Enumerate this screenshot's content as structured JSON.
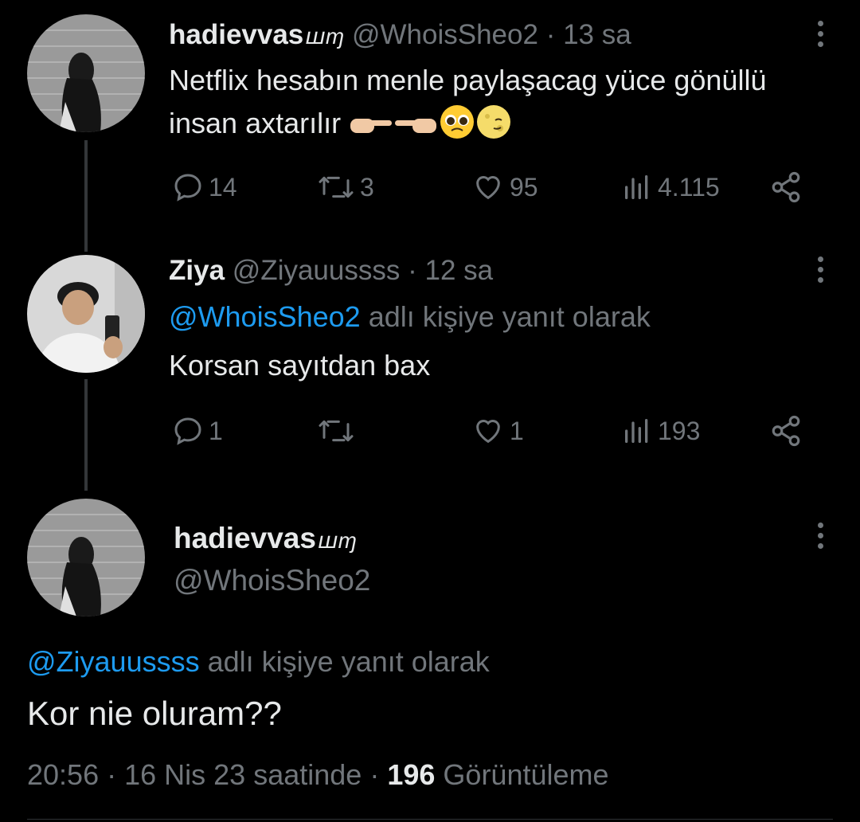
{
  "tweets": [
    {
      "name": "hadievvas",
      "name_glyph": "ꟺɱ",
      "handle": "@WhoisSheo2",
      "separator": "·",
      "time": "13 sa",
      "text": "Netflix hesabın menle paylaşacag yüce gönüllü insan axtarılır",
      "emoji": [
        "pointing-right-hand",
        "pointing-left-hand",
        "pleading-face",
        "smirking-moon"
      ],
      "actions": {
        "replies": "14",
        "retweets": "3",
        "likes": "95",
        "views": "4.115"
      }
    },
    {
      "name": "Ziya",
      "handle": "@Ziyauussss",
      "separator": "·",
      "time": "12 sa",
      "reply_to_mention": "@WhoisSheo2",
      "reply_to_suffix": "adlı kişiye yanıt olarak",
      "text": "Korsan sayıtdan bax",
      "actions": {
        "replies": "1",
        "retweets": "",
        "likes": "1",
        "views": "193"
      }
    }
  ],
  "main": {
    "name": "hadievvas",
    "name_glyph": "ꟺɱ",
    "handle": "@WhoisSheo2",
    "reply_to_mention": "@Ziyauussss",
    "reply_to_suffix": "adlı kişiye yanıt olarak",
    "text": "Kor nie oluram??",
    "time": "20:56",
    "date": "16 Nis 23 saatinde",
    "views_count": "196",
    "views_label": "Görüntüleme"
  },
  "colors": {
    "accent": "#1d9bf0",
    "muted": "#71767b",
    "text": "#e7e9ea",
    "background": "#000000"
  }
}
